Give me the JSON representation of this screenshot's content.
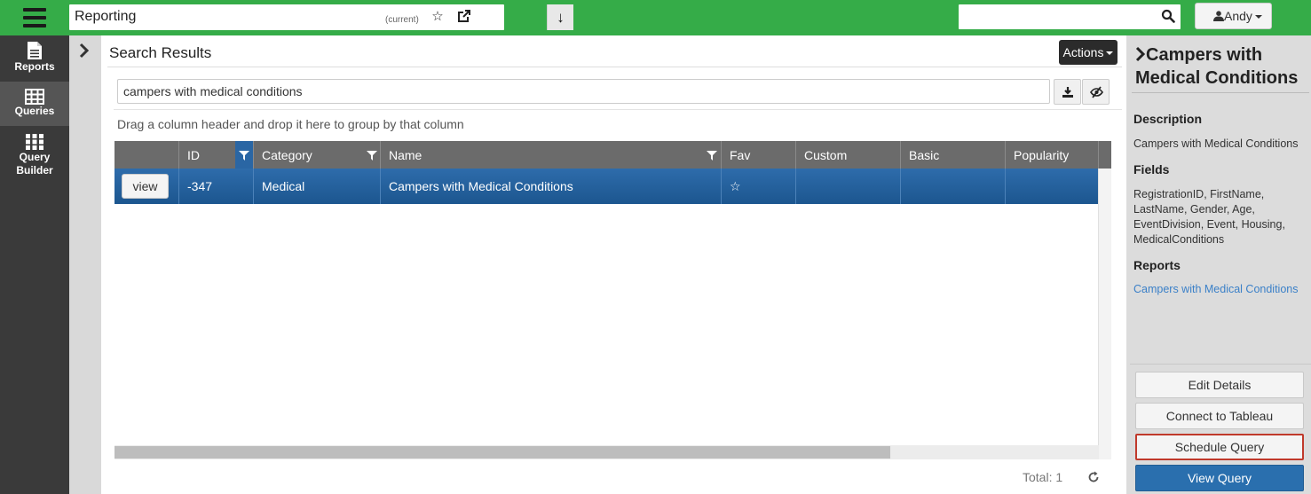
{
  "topbar": {
    "app_title": "Reporting",
    "app_state": "(current)",
    "search_value": "",
    "user_name": "Andy"
  },
  "sidebar": {
    "items": [
      {
        "label": "Reports",
        "icon": "document-icon"
      },
      {
        "label": "Queries",
        "icon": "table-icon",
        "active": true
      },
      {
        "label": "Query Builder",
        "icon": "grid-icon"
      }
    ]
  },
  "main": {
    "title": "Search Results",
    "actions_label": "Actions",
    "query_value": "campers with medical conditions",
    "group_hint": "Drag a column header and drop it here to group by that column",
    "columns": [
      "ID",
      "Category",
      "Name",
      "Fav",
      "Custom",
      "Basic",
      "Popularity"
    ],
    "rows": [
      {
        "view_label": "view",
        "id": "-347",
        "category": "Medical",
        "name": "Campers with Medical Conditions",
        "fav": "☆",
        "custom": "",
        "basic": "",
        "popularity": ""
      }
    ],
    "total_label": "Total: 1",
    "colors": {
      "header_bg": "#6b6b6b",
      "selected_row": "#2e6cab",
      "filter_active": "#2a66a4"
    }
  },
  "details": {
    "title": "Campers with Medical Conditions",
    "description_heading": "Description",
    "description": "Campers with Medical Conditions",
    "fields_heading": "Fields",
    "fields": "RegistrationID, FirstName, LastName, Gender, Age, EventDivision, Event, Housing, MedicalConditions",
    "reports_heading": "Reports",
    "report_link": "Campers with Medical Conditions",
    "buttons": {
      "edit": "Edit Details",
      "tableau": "Connect to Tableau",
      "schedule": "Schedule Query",
      "view": "View Query"
    }
  },
  "colors": {
    "topbar": "#35ac48",
    "sidebar": "#3a3a3a",
    "primary": "#2a6fae",
    "highlight_border": "#c0392b"
  }
}
